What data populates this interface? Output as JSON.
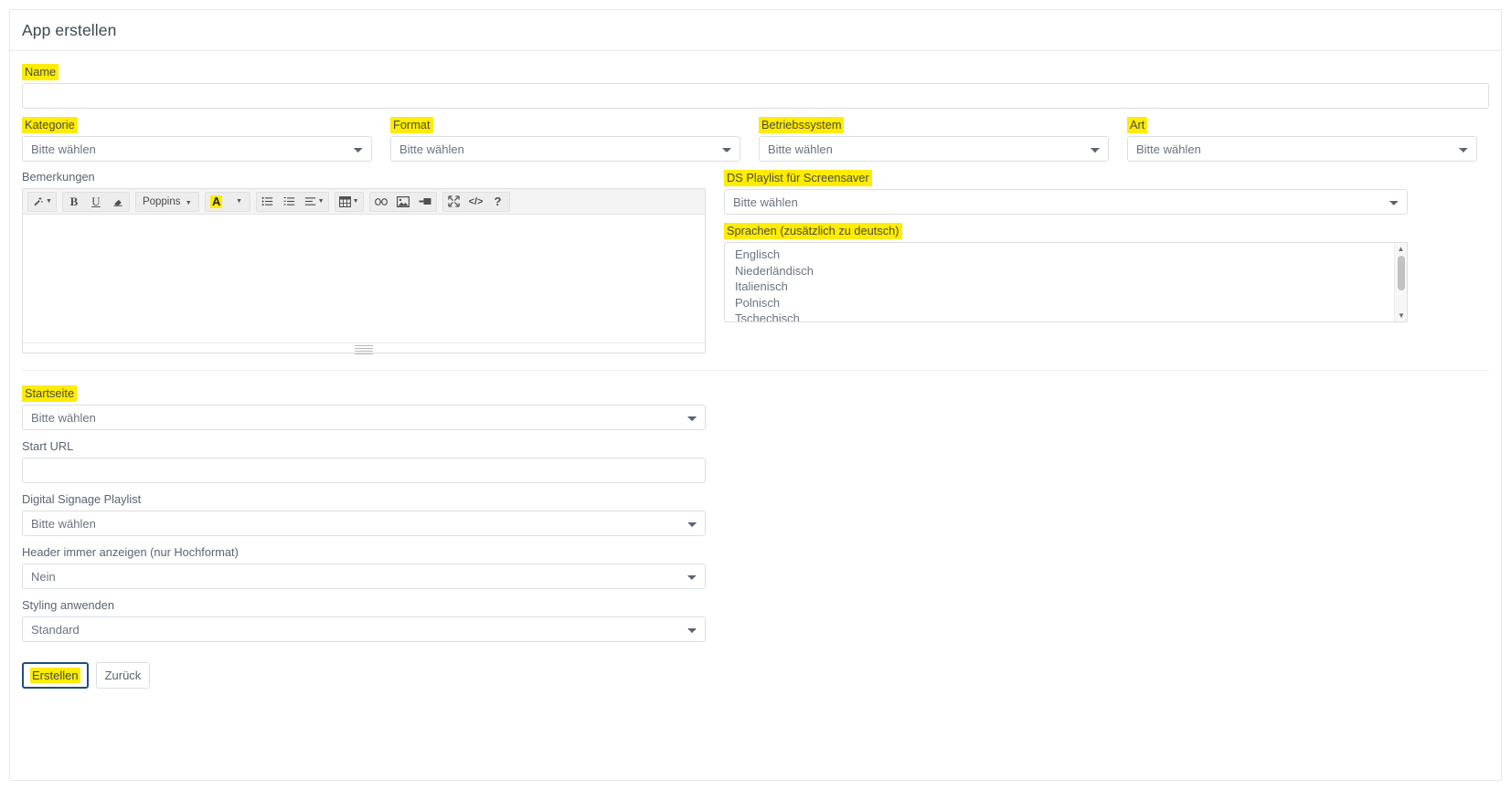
{
  "header": {
    "title": "App erstellen"
  },
  "form": {
    "name": {
      "label": "Name",
      "value": "",
      "placeholder": ""
    },
    "kategorie": {
      "label": "Kategorie",
      "value": "Bitte wählen"
    },
    "format": {
      "label": "Format",
      "value": "Bitte wählen"
    },
    "betriebssystem": {
      "label": "Betriebssystem",
      "value": "Bitte wählen"
    },
    "art": {
      "label": "Art",
      "value": "Bitte wählen"
    },
    "bemerkungen": {
      "label": "Bemerkungen",
      "content": ""
    },
    "ds_playlist_screensaver": {
      "label": "DS Playlist für Screensaver",
      "value": "Bitte wählen"
    },
    "sprachen": {
      "label": "Sprachen (zusätzlich zu deutsch)",
      "options": [
        "Englisch",
        "Niederländisch",
        "Italienisch",
        "Polnisch",
        "Tschechisch"
      ]
    },
    "startseite": {
      "label": "Startseite",
      "value": "Bitte wählen"
    },
    "start_url": {
      "label": "Start URL",
      "value": "",
      "placeholder": ""
    },
    "digital_signage_playlist": {
      "label": "Digital Signage Playlist",
      "value": "Bitte wählen"
    },
    "header_immer_anzeigen": {
      "label": "Header immer anzeigen (nur Hochformat)",
      "value": "Nein"
    },
    "styling_anwenden": {
      "label": "Styling anwenden",
      "value": "Standard"
    }
  },
  "editor_toolbar": {
    "font_name": "Poppins",
    "icons": [
      "magic-wand-icon",
      "bold-icon",
      "underline-icon",
      "eraser-icon",
      "font-family-icon",
      "text-color-icon",
      "bullet-list-icon",
      "numbered-list-icon",
      "align-icon",
      "table-icon",
      "link-icon",
      "image-icon",
      "media-icon",
      "fullscreen-icon",
      "source-code-icon",
      "help-icon"
    ],
    "bold_label": "B",
    "underline_label": "U",
    "color_letter": "A",
    "code_label": "</>",
    "help_label": "?"
  },
  "buttons": {
    "submit": "Erstellen",
    "back": "Zurück"
  },
  "colors": {
    "highlight": "#ffec00",
    "primary_border": "#1f4e79",
    "text": "#5a6472"
  }
}
